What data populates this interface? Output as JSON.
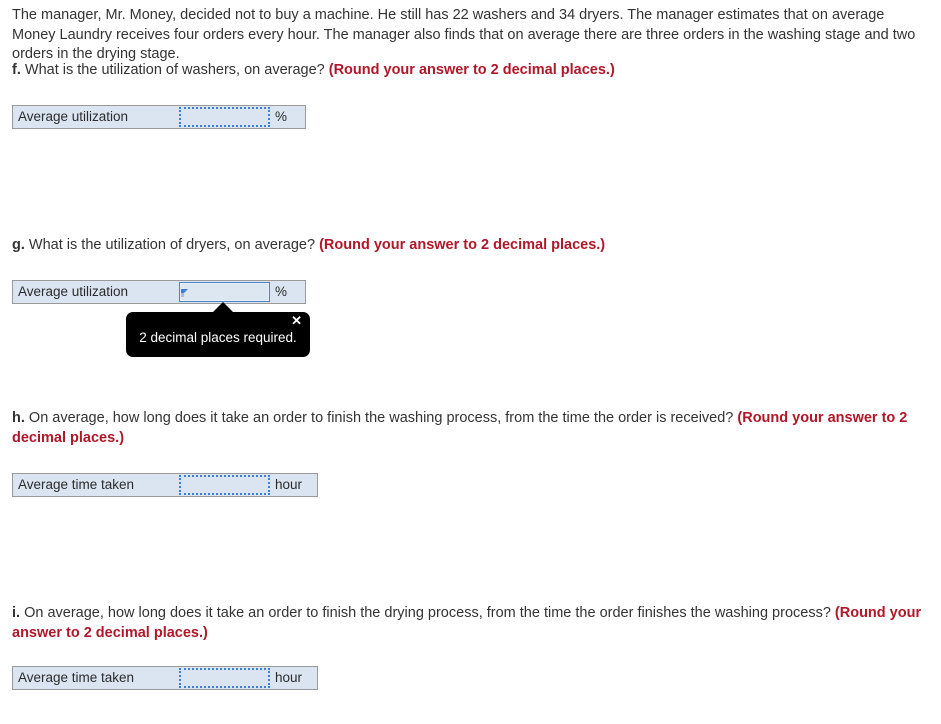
{
  "intro": {
    "text": "The manager, Mr. Money, decided not to buy a machine. He still has 22 washers and 34 dryers. The manager estimates that on average Money Laundry receives four orders every hour. The manager also finds that on average there are three orders in the washing stage and two orders in the drying stage."
  },
  "questions": {
    "f": {
      "letter": "f.",
      "prompt": " What is the utilization of washers, on average? ",
      "round_note": "(Round your answer to 2 decimal places.)",
      "field": {
        "label": "Average utilization",
        "value": "",
        "placeholder": "",
        "unit": "%",
        "focused": false
      }
    },
    "g": {
      "letter": "g.",
      "prompt": " What is the utilization of dryers, on average? ",
      "round_note": "(Round your answer to 2 decimal places.)",
      "field": {
        "label": "Average utilization",
        "value": "",
        "placeholder": "",
        "unit": "%",
        "focused": true
      }
    },
    "h": {
      "letter": "h.",
      "prompt": " On average, how long does it take an order to finish the washing process, from the time the order is received? ",
      "round_note": "(Round your answer to 2 decimal places.)",
      "field": {
        "label": "Average time taken",
        "value": "",
        "placeholder": "",
        "unit": "hour",
        "focused": false
      }
    },
    "i": {
      "letter": "i.",
      "prompt": " On average, how long does it take an order to finish the drying process, from the time the order finishes the washing process? ",
      "round_note": "(Round your answer to 2 decimal places.)",
      "field": {
        "label": "Average time taken",
        "value": "",
        "placeholder": "",
        "unit": "hour",
        "focused": false
      }
    }
  },
  "tooltip": {
    "message": "2 decimal places required.",
    "close_label": "✕"
  },
  "colors": {
    "body_text": "#333333",
    "round_note_red": "#b01729",
    "field_background": "#dbe5f1",
    "field_border": "#9a9a9a",
    "input_border_blue": "#3c7fd0",
    "input_focus_border": "#4a84c4",
    "tooltip_background": "#000000",
    "tooltip_text": "#ffffff"
  }
}
